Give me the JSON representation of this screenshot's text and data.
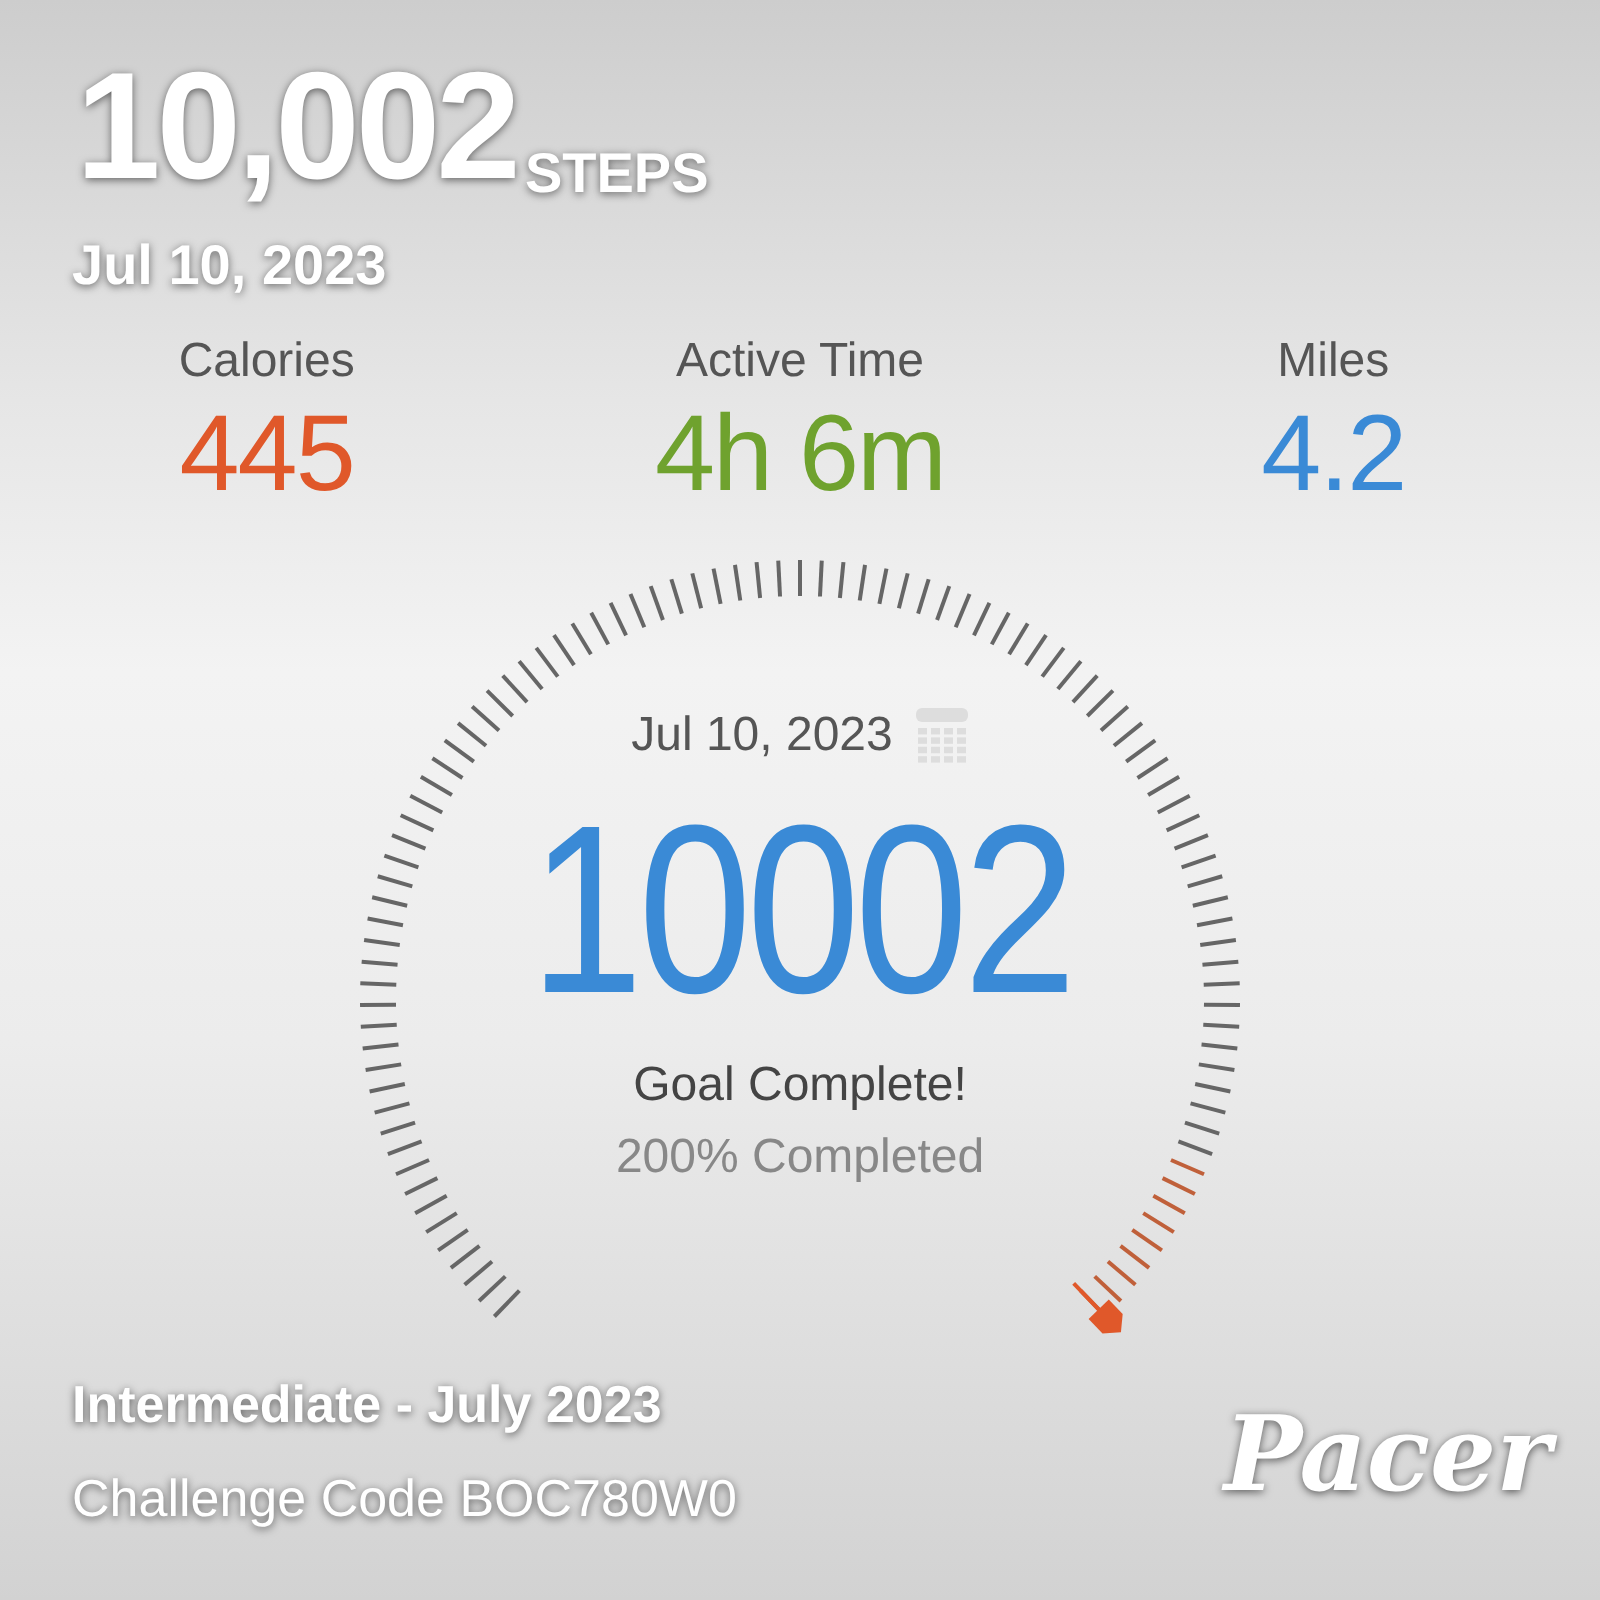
{
  "stats": [
    {
      "label": "Calories",
      "value": "445",
      "color": "#e0582a"
    },
    {
      "label": "Active Time",
      "value": "4h 6m",
      "color": "#6fa22e"
    },
    {
      "label": "Miles",
      "value": "4.2",
      "color": "#3a8ad6"
    }
  ],
  "gauge": {
    "date": "Jul 10, 2023",
    "steps": "10002",
    "status": "Goal Complete!",
    "percent": "200% Completed"
  },
  "overlay": {
    "steps": "10,002",
    "unit": "STEPS",
    "date": "Jul 10, 2023",
    "challenge": "Intermediate - July 2023",
    "code": "Challenge Code BOC780W0",
    "brand": "Pacer"
  }
}
